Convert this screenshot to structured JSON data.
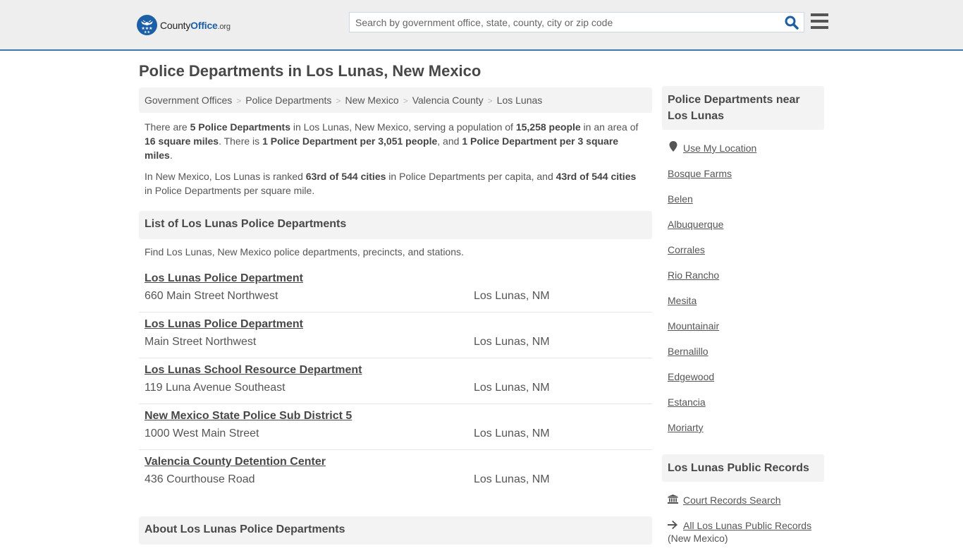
{
  "header": {
    "logo": {
      "name_part1": "County",
      "name_part2": "Office",
      "tld": ".org"
    },
    "search": {
      "placeholder": "Search by government office, state, county, city or zip code",
      "value": ""
    },
    "colors": {
      "brand": "#1d5fa6",
      "accent_border": "#3a78b0"
    }
  },
  "page": {
    "title": "Police Departments in Los Lunas, New Mexico"
  },
  "breadcrumb": [
    {
      "label": "Government Offices"
    },
    {
      "label": "Police Departments"
    },
    {
      "label": "New Mexico"
    },
    {
      "label": "Valencia County"
    },
    {
      "label": "Los Lunas"
    }
  ],
  "intro": {
    "p1": {
      "t1": "There are ",
      "b1": "5 Police Departments",
      "t2": " in Los Lunas, New Mexico, serving a population of ",
      "b2": "15,258 people",
      "t3": " in an area of ",
      "b3": "16 square miles",
      "t4": ". There is ",
      "b4": "1 Police Department per 3,051 people",
      "t5": ", and ",
      "b5": "1 Police Department per 3 square miles",
      "t6": "."
    },
    "p2": {
      "t1": "In New Mexico, Los Lunas is ranked ",
      "b1": "63rd of 544 cities",
      "t2": " in Police Departments per capita, and ",
      "b2": "43rd of 544 cities",
      "t3": " in Police Departments per square mile."
    }
  },
  "list_section": {
    "heading": "List of Los Lunas Police Departments",
    "description": "Find Los Lunas, New Mexico police departments, precincts, and stations.",
    "departments": [
      {
        "name": "Los Lunas Police Department",
        "address": "660 Main Street Northwest",
        "city": "Los Lunas, NM"
      },
      {
        "name": "Los Lunas Police Department",
        "address": "Main Street Northwest",
        "city": "Los Lunas, NM"
      },
      {
        "name": "Los Lunas School Resource Department",
        "address": "119 Luna Avenue Southeast",
        "city": "Los Lunas, NM"
      },
      {
        "name": "New Mexico State Police Sub District 5",
        "address": "1000 West Main Street",
        "city": "Los Lunas, NM"
      },
      {
        "name": "Valencia County Detention Center",
        "address": "436 Courthouse Road",
        "city": "Los Lunas, NM"
      }
    ]
  },
  "about_section": {
    "heading": "About Los Lunas Police Departments"
  },
  "sidebar": {
    "nearby": {
      "heading": "Police Departments near Los Lunas",
      "use_location": {
        "label": "Use My Location",
        "icon": "map-marker-icon"
      },
      "cities": [
        "Bosque Farms",
        "Belen",
        "Albuquerque",
        "Corrales",
        "Rio Rancho",
        "Mesita",
        "Mountainair",
        "Bernalillo",
        "Edgewood",
        "Estancia",
        "Moriarty"
      ]
    },
    "records": {
      "heading": "Los Lunas Public Records",
      "links": [
        {
          "label": "Court Records Search",
          "icon": "courthouse-icon"
        },
        {
          "label": "All Los Lunas Public Records",
          "suffix": "(New Mexico)",
          "icon": "arrow-right-icon"
        }
      ]
    }
  }
}
